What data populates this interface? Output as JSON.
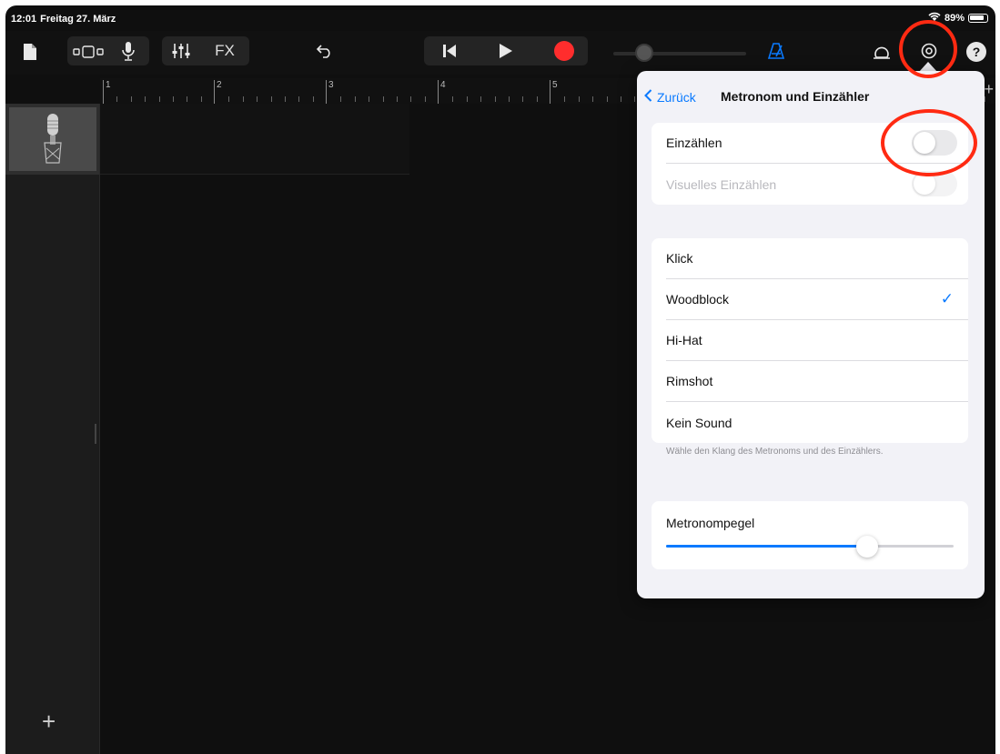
{
  "status": {
    "time": "12:01",
    "date": "Freitag 27. März",
    "battery": "89%"
  },
  "toolbar": {
    "fx_label": "FX"
  },
  "ruler": {
    "bars": [
      "1",
      "2",
      "3",
      "4",
      "5"
    ]
  },
  "popover": {
    "back_label": "Zurück",
    "title": "Metronom und Einzähler",
    "countin": {
      "label": "Einzählen",
      "enabled": false,
      "visual_label": "Visuelles Einzählen",
      "visual_enabled": false
    },
    "sounds": [
      {
        "label": "Klick",
        "selected": false
      },
      {
        "label": "Woodblock",
        "selected": true
      },
      {
        "label": "Hi-Hat",
        "selected": false
      },
      {
        "label": "Rimshot",
        "selected": false
      },
      {
        "label": "Kein Sound",
        "selected": false
      }
    ],
    "sounds_footnote": "Wähle den Klang des Metronoms und des Einzählers.",
    "volume": {
      "label": "Metronompegel",
      "level": 0.7
    }
  },
  "colors": {
    "accent": "#0a7aff",
    "record": "#ff2d2d",
    "annotation": "#ff2a12"
  }
}
